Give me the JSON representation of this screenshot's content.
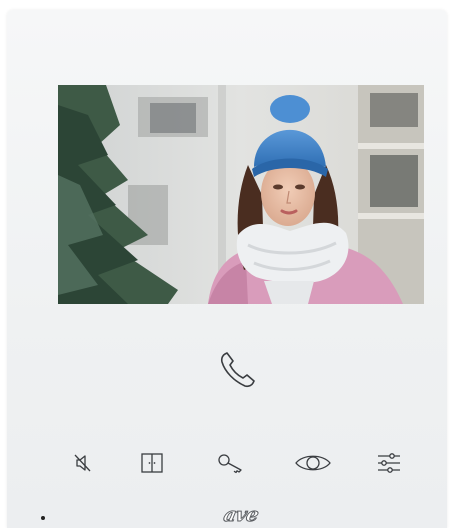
{
  "device": {
    "brand_logo": "ave",
    "screen_content": "video-feed-woman-blue-hat",
    "status_led": "led-indicator"
  },
  "controls": {
    "call": {
      "icon": "phone-handset-icon"
    },
    "buttons": [
      {
        "icon": "speaker-mute-icon"
      },
      {
        "icon": "door-open-icon"
      },
      {
        "icon": "key-icon"
      },
      {
        "icon": "eye-icon"
      },
      {
        "icon": "sliders-settings-icon"
      }
    ]
  },
  "colors": {
    "panel": "#f2f4f5",
    "icon_stroke": "#3a3d41",
    "hat": "#3f7fc7",
    "scarf": "#eef0f2",
    "sweater": "#d79ab8"
  }
}
